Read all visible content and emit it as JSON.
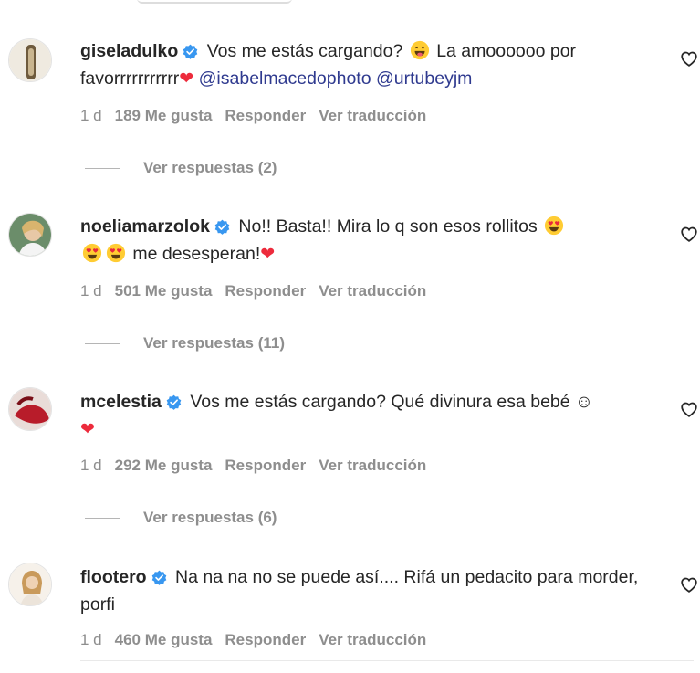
{
  "comments": [
    {
      "username": "giseladulko",
      "text_1": "Vos me estás cargando?",
      "text_2": "La amoooooo por favorrrrrrrrrrr",
      "mention_1": "@isabelmacedophoto",
      "mention_2": "@urtubeyjm",
      "time": "1 d",
      "likes": "189 Me gusta",
      "reply": "Responder",
      "translate": "Ver traducción",
      "view_replies": "Ver respuestas (2)"
    },
    {
      "username": "noeliamarzolok",
      "text_1": "No!! Basta!! Mira lo q son esos rollitos",
      "text_2": "me desesperan!",
      "time": "1 d",
      "likes": "501 Me gusta",
      "reply": "Responder",
      "translate": "Ver traducción",
      "view_replies": "Ver respuestas (11)"
    },
    {
      "username": "mcelestia",
      "text_1": "Vos me estás cargando? Qué divinura esa bebé",
      "time": "1 d",
      "likes": "292 Me gusta",
      "reply": "Responder",
      "translate": "Ver traducción",
      "view_replies": "Ver respuestas (6)"
    },
    {
      "username": "flootero",
      "text_1": "Na na na no se puede así.... Rifá un pedacito para morder, porfi",
      "time": "1 d",
      "likes": "460 Me gusta",
      "reply": "Responder",
      "translate": "Ver traducción"
    }
  ],
  "colors": {
    "verified": "#3897f0",
    "heart": "#ed2b3c",
    "mention": "#2f3a8f",
    "meta": "#8e8e8e"
  },
  "icons": [
    "verified-badge-icon",
    "heart-outline-icon",
    "red-heart-emoji",
    "grinning-tongue-emoji",
    "heart-eyes-emoji",
    "smiling-face-icon"
  ]
}
